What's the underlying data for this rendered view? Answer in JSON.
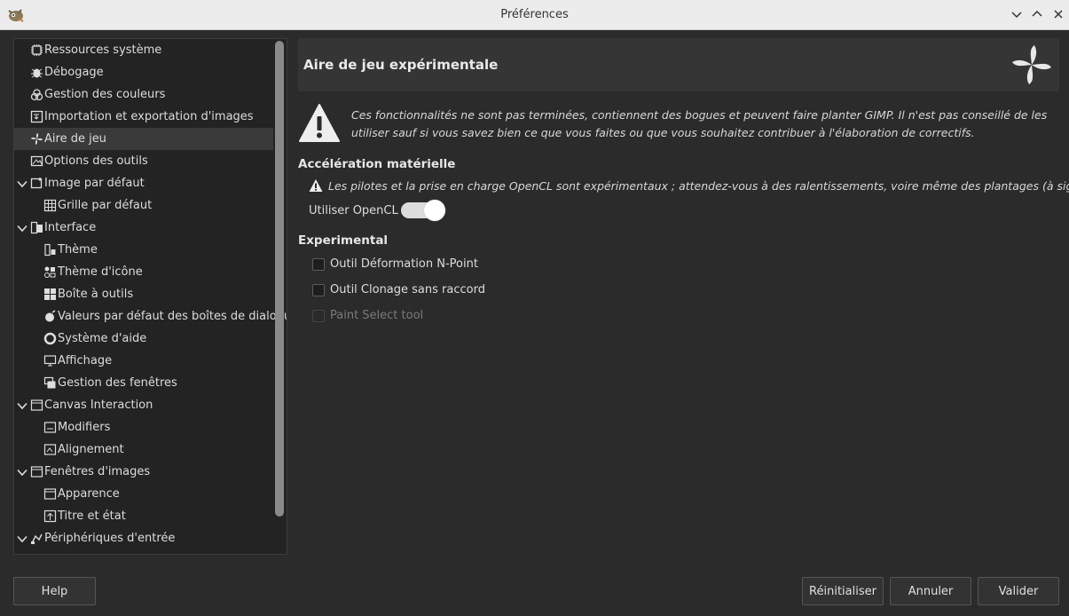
{
  "window": {
    "title": "Préférences",
    "icon": "gimp-icon"
  },
  "sidebar": {
    "items": [
      {
        "label": "Ressources système",
        "icon": "chip-icon",
        "level": 0,
        "expander": false,
        "selected": false
      },
      {
        "label": "Débogage",
        "icon": "bug-icon",
        "level": 0,
        "expander": false,
        "selected": false
      },
      {
        "label": "Gestion des couleurs",
        "icon": "color-icon",
        "level": 0,
        "expander": false,
        "selected": false
      },
      {
        "label": "Importation et exportation d'images",
        "icon": "import-export-icon",
        "level": 0,
        "expander": false,
        "selected": false
      },
      {
        "label": "Aire de jeu",
        "icon": "pinwheel-icon",
        "level": 0,
        "expander": false,
        "selected": true
      },
      {
        "label": "Options des outils",
        "icon": "tool-options-icon",
        "level": 0,
        "expander": false,
        "selected": false
      },
      {
        "label": "Image par défaut",
        "icon": "image-icon",
        "level": 0,
        "expander": true,
        "selected": false
      },
      {
        "label": "Grille par défaut",
        "icon": "grid-icon",
        "level": 1,
        "expander": false,
        "selected": false
      },
      {
        "label": "Interface",
        "icon": "interface-icon",
        "level": 0,
        "expander": true,
        "selected": false
      },
      {
        "label": "Thème",
        "icon": "theme-icon",
        "level": 1,
        "expander": false,
        "selected": false
      },
      {
        "label": "Thème d'icône",
        "icon": "icon-theme-icon",
        "level": 1,
        "expander": false,
        "selected": false
      },
      {
        "label": "Boîte à outils",
        "icon": "toolbox-icon",
        "level": 1,
        "expander": false,
        "selected": false
      },
      {
        "label": "Valeurs par défaut des boîtes de dialogue",
        "icon": "dialog-defaults-icon",
        "level": 1,
        "expander": false,
        "selected": false
      },
      {
        "label": "Système d'aide",
        "icon": "help-icon",
        "level": 1,
        "expander": false,
        "selected": false
      },
      {
        "label": "Affichage",
        "icon": "display-icon",
        "level": 1,
        "expander": false,
        "selected": false
      },
      {
        "label": "Gestion des fenêtres",
        "icon": "windows-icon",
        "level": 1,
        "expander": false,
        "selected": false
      },
      {
        "label": "Canvas Interaction",
        "icon": "canvas-icon",
        "level": 0,
        "expander": true,
        "selected": false
      },
      {
        "label": "Modifiers",
        "icon": "modifiers-icon",
        "level": 1,
        "expander": false,
        "selected": false
      },
      {
        "label": "Alignement",
        "icon": "alignment-icon",
        "level": 1,
        "expander": false,
        "selected": false
      },
      {
        "label": "Fenêtres d'images",
        "icon": "image-windows-icon",
        "level": 0,
        "expander": true,
        "selected": false
      },
      {
        "label": "Apparence",
        "icon": "appearance-icon",
        "level": 1,
        "expander": false,
        "selected": false
      },
      {
        "label": "Titre et état",
        "icon": "title-status-icon",
        "level": 1,
        "expander": false,
        "selected": false
      },
      {
        "label": "Périphériques d'entrée",
        "icon": "input-devices-icon",
        "level": 0,
        "expander": true,
        "selected": false
      }
    ]
  },
  "main": {
    "page_title": "Aire de jeu expérimentale",
    "header_icon": "pinwheel-icon",
    "warning": "Ces fonctionnalités ne sont pas terminées, contiennent des bogues et peuvent faire planter GIMP. Il n'est pas conseillé de les utiliser sauf si vous savez bien ce que vous faites ou que vous souhaitez contribuer à l'élaboration de correctifs.",
    "hw_section": {
      "title": "Accélération matérielle",
      "warning": "Les pilotes et la prise en charge OpenCL sont expérimentaux ; attendez-vous à des ralentissements, voire même des plantages (à signaler).",
      "opencl_label": "Utiliser OpenCL",
      "opencl_enabled": true
    },
    "exp_section": {
      "title": "Experimental",
      "options": [
        {
          "label": "Outil Déformation N-Point",
          "checked": false,
          "disabled": false
        },
        {
          "label": "Outil Clonage sans raccord",
          "checked": false,
          "disabled": false
        },
        {
          "label": "Paint Select tool",
          "checked": false,
          "disabled": true
        }
      ]
    }
  },
  "buttons": {
    "help": "Help",
    "reset": "Réinitialiser",
    "cancel": "Annuler",
    "ok": "Valider"
  },
  "colors": {
    "background": "#2b2b2b",
    "selected_row": "#3a3a3a"
  }
}
